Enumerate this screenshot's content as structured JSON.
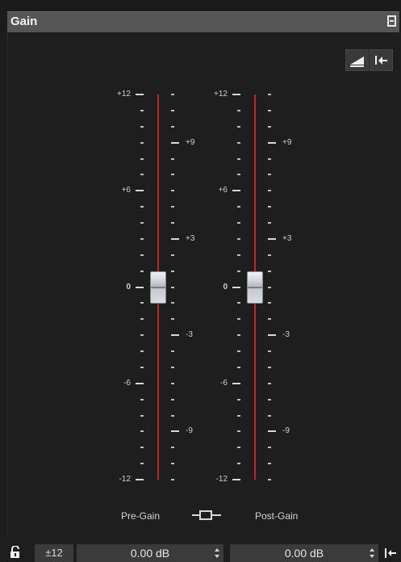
{
  "panel": {
    "title": "Gain"
  },
  "toolbar": {
    "ramp_icon": "ramp-icon",
    "reset_icon": "reset-to-zero-icon"
  },
  "faders": [
    {
      "label": "Pre-Gain",
      "value_db": 0.0,
      "scale_left": [
        "+12",
        "+6",
        "0",
        "-6",
        "-12"
      ],
      "scale_right": [
        "+9",
        "+3",
        "-3",
        "-9"
      ]
    },
    {
      "label": "Post-Gain",
      "value_db": 0.0,
      "scale_left": [
        "+12",
        "+6",
        "0",
        "-6",
        "-12"
      ],
      "scale_right": [
        "+9",
        "+3",
        "-3",
        "-9"
      ]
    }
  ],
  "footer": {
    "range_label": "±12",
    "pre_gain_value": "0.00 dB",
    "post_gain_value": "0.00 dB"
  },
  "colors": {
    "track": "#c22323",
    "background": "#1e1e1e",
    "header": "#555555"
  }
}
